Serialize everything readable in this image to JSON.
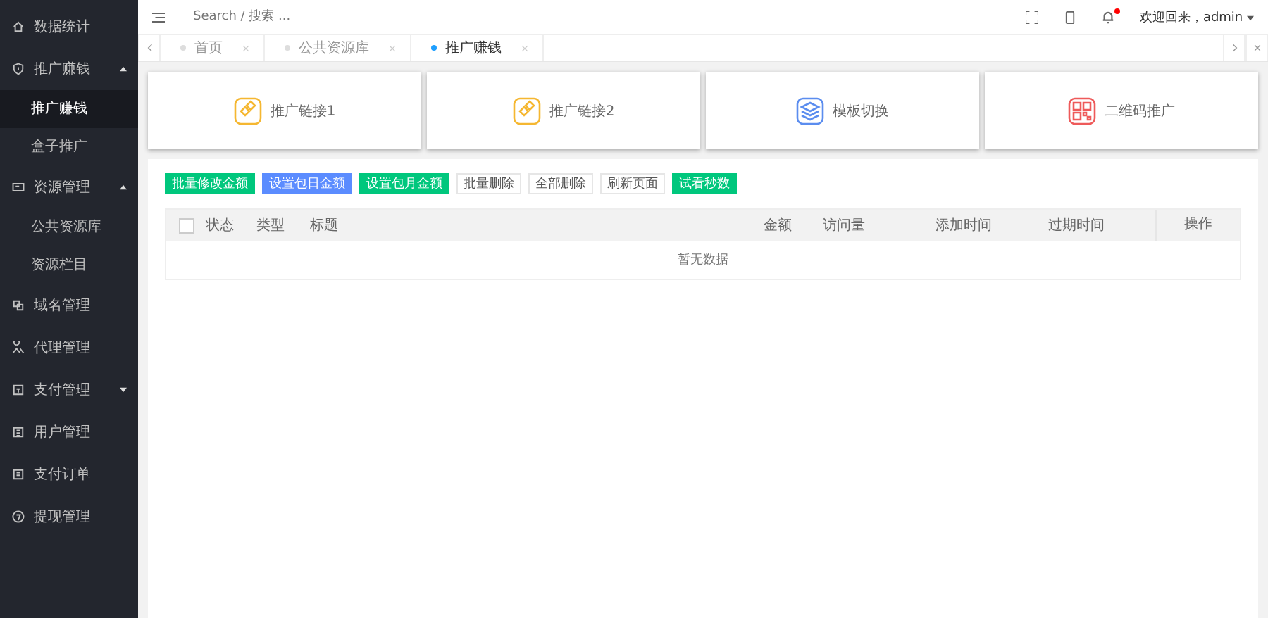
{
  "sidebar": {
    "items": [
      {
        "label": "数据统计",
        "selected": false
      },
      {
        "label": "推广赚钱",
        "selected": false,
        "expanded": true,
        "children": [
          {
            "label": "推广赚钱",
            "selected": true
          },
          {
            "label": "盒子推广",
            "selected": false
          }
        ]
      },
      {
        "label": "资源管理",
        "selected": false,
        "expanded": true,
        "children": [
          {
            "label": "公共资源库",
            "selected": false
          },
          {
            "label": "资源栏目",
            "selected": false
          }
        ]
      },
      {
        "label": "域名管理",
        "selected": false
      },
      {
        "label": "代理管理",
        "selected": false
      },
      {
        "label": "支付管理",
        "selected": false,
        "expanded": false
      },
      {
        "label": "用户管理",
        "selected": false
      },
      {
        "label": "支付订单",
        "selected": false
      },
      {
        "label": "提现管理",
        "selected": false
      }
    ]
  },
  "header": {
    "search": {
      "placeholder": "Search / 搜索 ..."
    },
    "notification_dot": true,
    "user": "欢迎回来，admin"
  },
  "tabs": [
    {
      "label": "首页",
      "selected": false
    },
    {
      "label": "公共资源库",
      "selected": false
    },
    {
      "label": "推广赚钱",
      "selected": true
    }
  ],
  "cards": [
    {
      "label": "推广链接1"
    },
    {
      "label": "推广链接2"
    },
    {
      "label": "模板切换"
    },
    {
      "label": "二维码推广"
    }
  ],
  "toolbar": [
    {
      "label": "批量修改金额",
      "kind": "green"
    },
    {
      "label": "设置包日金额",
      "kind": "blue"
    },
    {
      "label": "设置包月金额",
      "kind": "green"
    },
    {
      "label": "批量删除",
      "kind": "plain"
    },
    {
      "label": "全部删除",
      "kind": "plain"
    },
    {
      "label": "刷新页面",
      "kind": "plain"
    },
    {
      "label": "试看秒数",
      "kind": "green"
    }
  ],
  "table": {
    "select_all": {
      "checked": false
    },
    "columns": [
      "状态",
      "类型",
      "标题",
      "金额",
      "访问量",
      "添加时间",
      "过期时间",
      "操作"
    ],
    "empty": "暂无数据"
  }
}
